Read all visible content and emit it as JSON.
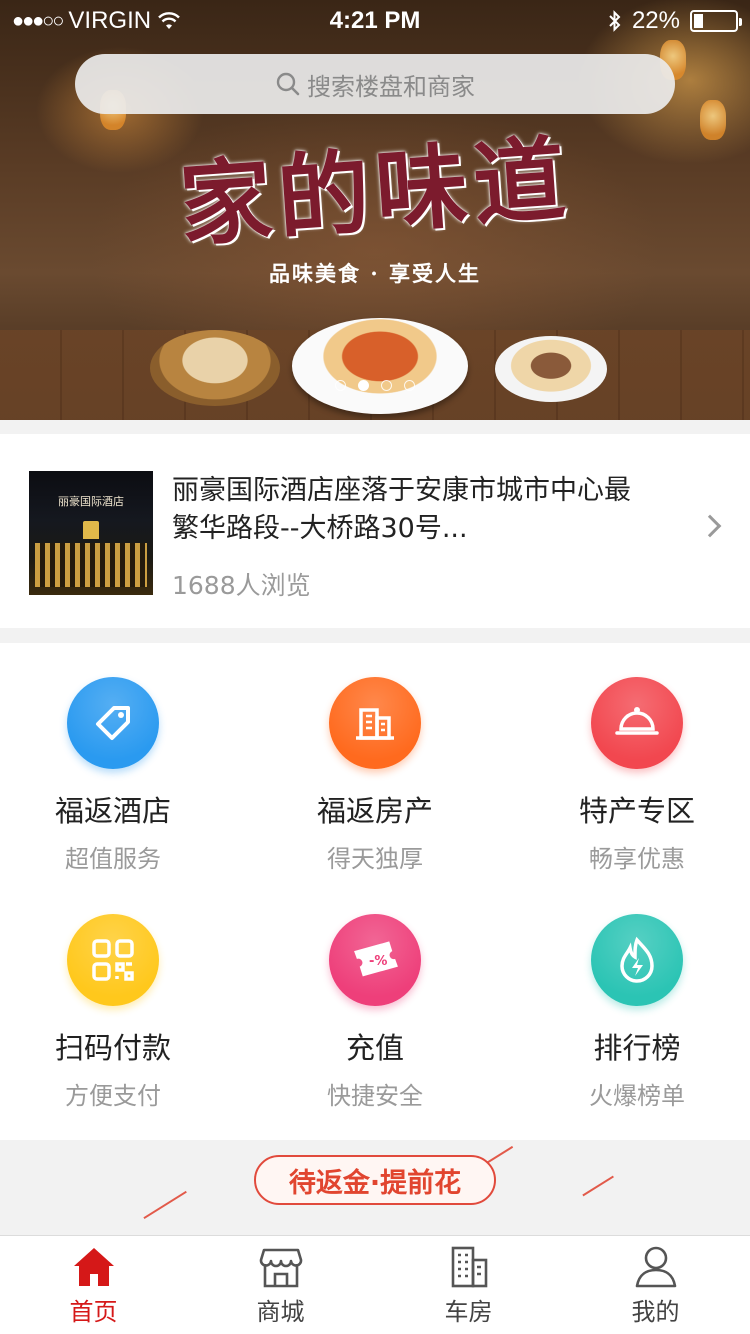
{
  "status_bar": {
    "signal_dots": "●●●○○",
    "carrier": "VIRGIN",
    "time": "4:21 PM",
    "battery_percent": "22%",
    "battery_level": 0.22
  },
  "search": {
    "placeholder": "搜索楼盘和商家",
    "icon": "search-icon"
  },
  "banner": {
    "title": "家的味道",
    "subtitle": "品味美食 · 享受人生",
    "page_count": 4,
    "active_page": 1
  },
  "hotel": {
    "thumb_name": "丽豪国际酒店",
    "description": "丽豪国际酒店座落于安康市城市中心最繁华路段--大桥路30号...",
    "views": "1688人浏览"
  },
  "features": [
    {
      "label": "福返酒店",
      "sub": "超值服务",
      "icon": "price-tag-icon",
      "color": "#2a9af0"
    },
    {
      "label": "福返房产",
      "sub": "得天独厚",
      "icon": "building-icon",
      "color": "#ff6a1e"
    },
    {
      "label": "特产专区",
      "sub": "畅享优惠",
      "icon": "food-cloche-icon",
      "color": "#f2474f"
    },
    {
      "label": "扫码付款",
      "sub": "方便支付",
      "icon": "qr-code-icon",
      "color": "#ffc81c"
    },
    {
      "label": "充值",
      "sub": "快捷安全",
      "icon": "coupon-icon",
      "color": "#ee3f7a"
    },
    {
      "label": "排行榜",
      "sub": "火爆榜单",
      "icon": "flame-icon",
      "color": "#2bc4b4"
    }
  ],
  "promo": {
    "text": "待返金·提前花",
    "color": "#e1452f"
  },
  "tabbar": [
    {
      "label": "首页",
      "icon": "home-icon",
      "active": true
    },
    {
      "label": "商城",
      "icon": "shop-icon",
      "active": false
    },
    {
      "label": "车房",
      "icon": "building-icon",
      "active": false
    },
    {
      "label": "我的",
      "icon": "user-icon",
      "active": false
    }
  ],
  "colors": {
    "accent": "#d51818",
    "muted_text": "#9a9a9a"
  }
}
